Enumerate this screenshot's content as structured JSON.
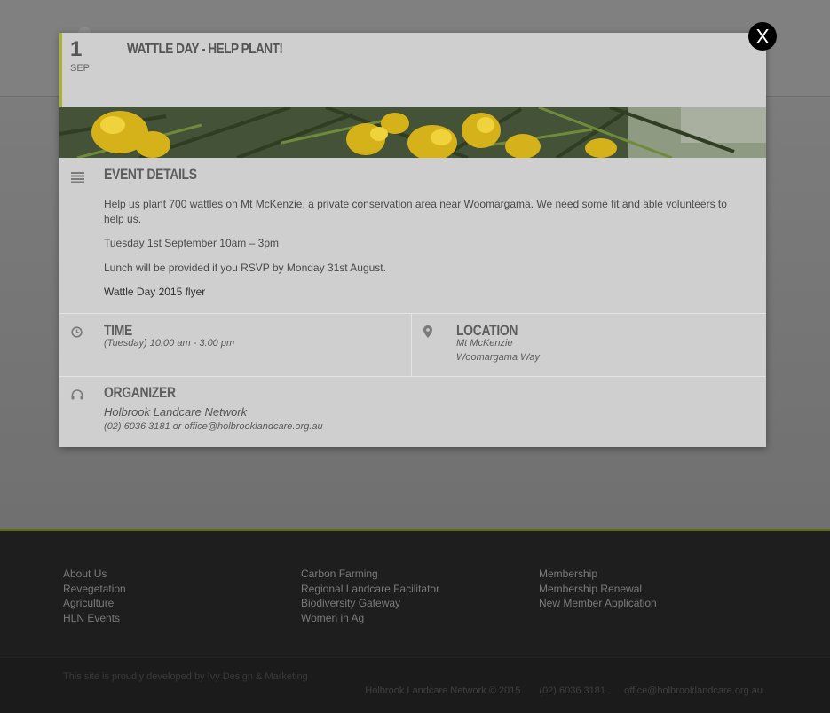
{
  "modal": {
    "close_label": "X",
    "date_day": "1",
    "date_month": "SEP",
    "title": "WATTLE DAY - HELP PLANT!",
    "details_heading": "EVENT DETAILS",
    "details_paragraphs": [
      "Help us plant 700 wattles on Mt McKenzie, a private conservation area near Woomargama. We need some fit and able volunteers to help us.",
      "Tuesday 1st September 10am – 3pm",
      "Lunch will be provided if you RSVP by Monday 31st August."
    ],
    "flyer_link": "Wattle Day 2015 flyer",
    "time_heading": "TIME",
    "time_value": "(Tuesday) 10:00 am - 3:00 pm",
    "location_heading": "LOCATION",
    "location_line1": "Mt McKenzie",
    "location_line2": "Woomargama Way",
    "organizer_heading": "ORGANIZER",
    "organizer_name": "Holbrook Landcare Network",
    "organizer_contact": "(02) 6036 3181 or office@holbrooklandcare.org.au"
  },
  "footer": {
    "col1": [
      "About Us",
      "Revegetation",
      "Agriculture",
      "HLN Events"
    ],
    "col2": [
      "Carbon Farming",
      "Regional Landcare Facilitator",
      "Biodiversity Gateway",
      "Women in Ag"
    ],
    "col3": [
      "Membership",
      "Membership Renewal",
      "New Member Application"
    ],
    "credit": "This site is proudly developed by Ivy Design & Marketing",
    "copyright": "Holbrook Landcare Network © 2015",
    "phone": "(02) 6036 3181",
    "email": "office@holbrooklandcare.org.au"
  },
  "colors": {
    "accent": "#a8b42a",
    "footer_bg": "#1e1e1e",
    "modal_bg": "#cfcfcf"
  }
}
